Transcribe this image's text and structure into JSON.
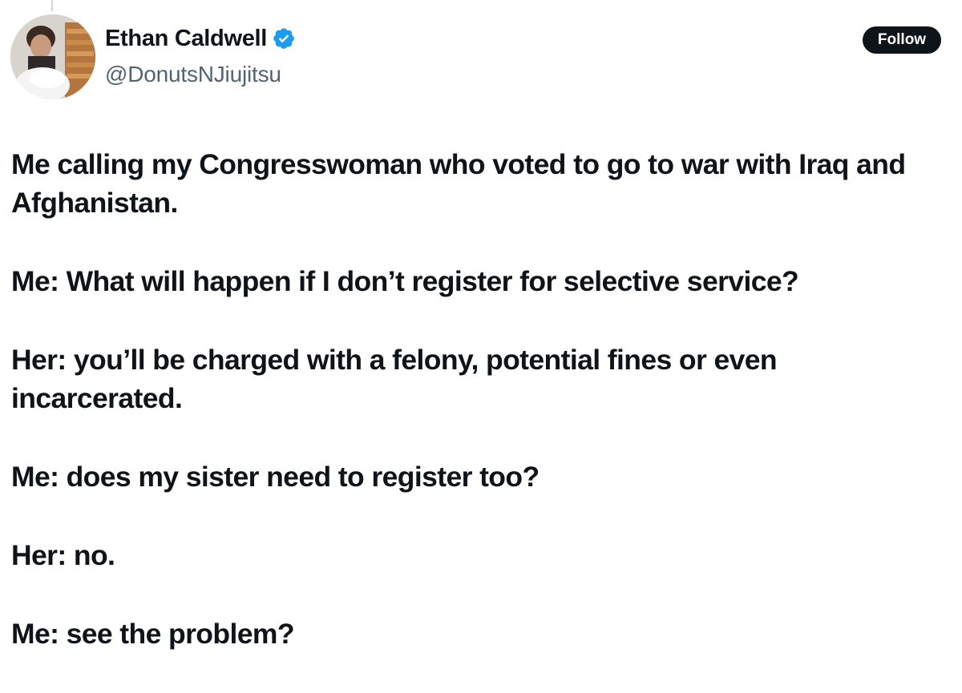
{
  "author": {
    "display_name": "Ethan Caldwell",
    "handle": "@DonutsNJiujitsu",
    "verified": true,
    "avatar_icon": "avatar-photo",
    "verified_icon": "verified-badge-icon",
    "verified_color": "#1d9bf0"
  },
  "actions": {
    "follow_label": "Follow"
  },
  "tweet": {
    "paragraphs": [
      "Me calling my Congresswoman who voted to go to war with Iraq and Afghanistan.",
      "Me: What will happen if I don’t register for selective service?",
      "Her: you’ll be charged with a felony, potential fines or even incarcerated.",
      "Me: does my sister need to register too?",
      "Her: no.",
      "Me: see the problem?"
    ]
  },
  "colors": {
    "text": "#0f1419",
    "secondary_text": "#536471",
    "button_bg": "#0f1419",
    "button_text": "#ffffff"
  }
}
